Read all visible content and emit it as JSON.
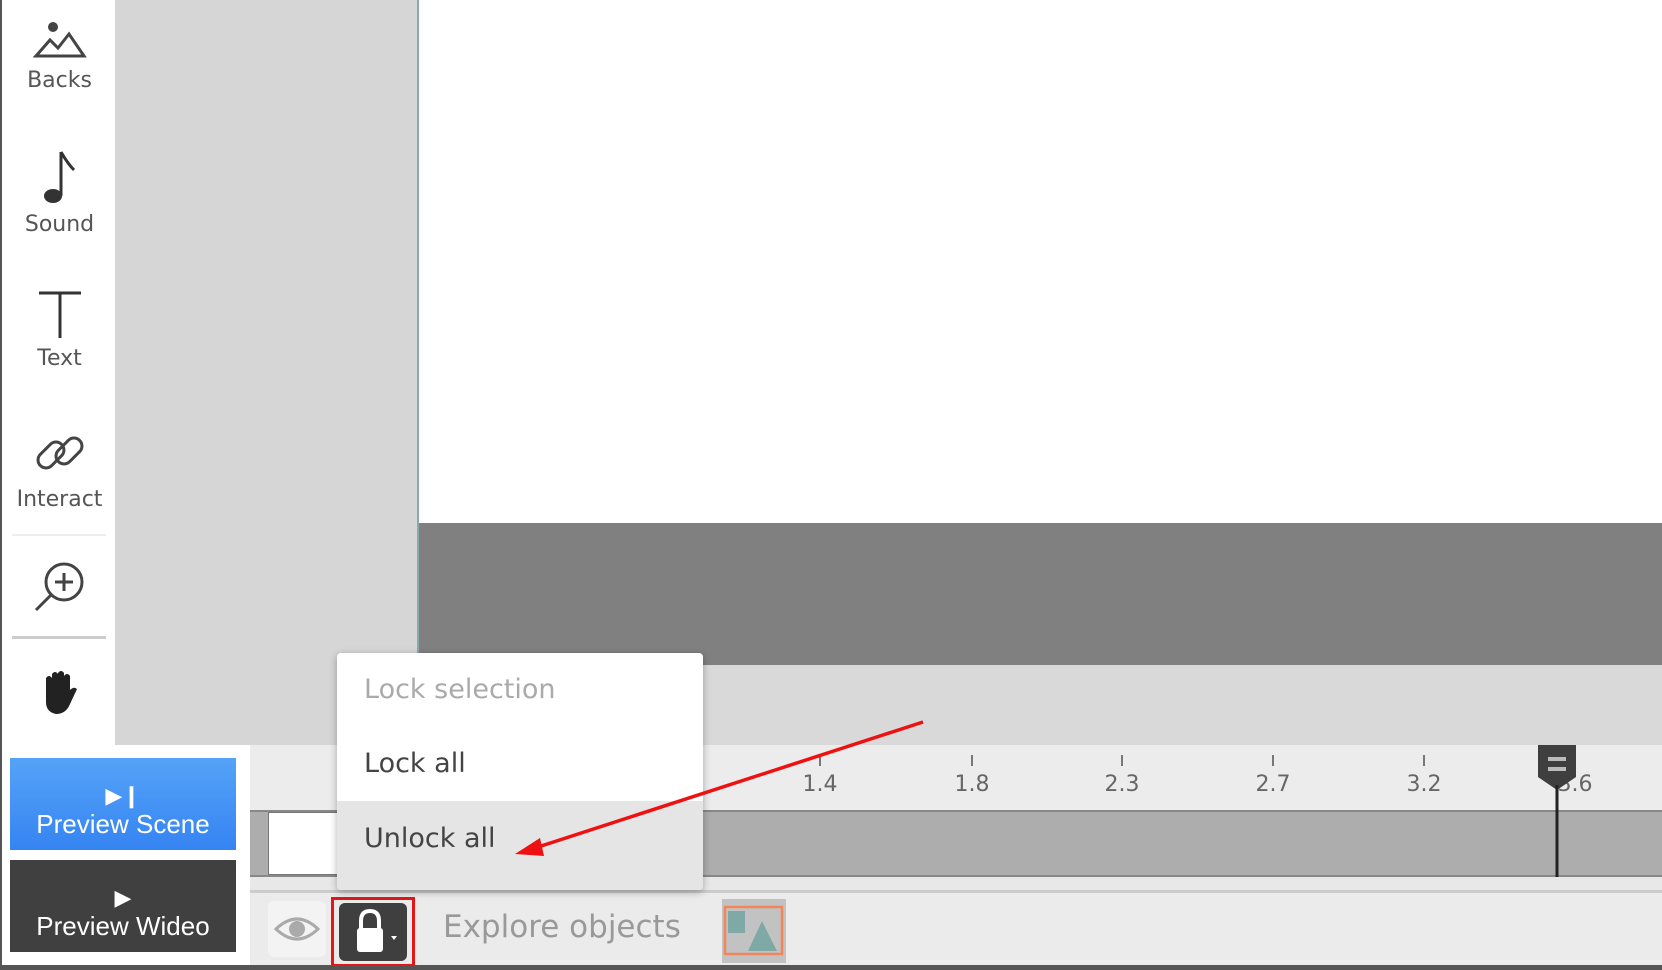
{
  "sidebar": {
    "items": [
      {
        "label": "Backs",
        "icon": "mountain-icon"
      },
      {
        "label": "Sound",
        "icon": "music-note-icon"
      },
      {
        "label": "Text",
        "icon": "text-icon"
      },
      {
        "label": "Interact",
        "icon": "link-icon"
      }
    ],
    "zoom_icon": "zoom-in-icon",
    "hand_icon": "hand-icon"
  },
  "preview": {
    "scene_label": "Preview Scene",
    "video_label": "Preview Wideo",
    "scene_color": "#3d8ef5",
    "video_color": "#404040"
  },
  "timeline": {
    "ticks": [
      "1.4",
      "1.8",
      "2.3",
      "2.7",
      "3.2",
      "3.6"
    ]
  },
  "lock_menu": {
    "items": [
      {
        "label": "Lock selection",
        "disabled": true
      },
      {
        "label": "Lock all",
        "disabled": false
      },
      {
        "label": "Unlock all",
        "disabled": false,
        "highlighted": true
      }
    ]
  },
  "bottom_bar": {
    "explore_label": "Explore objects"
  },
  "annotation": {
    "color": "#ee1111"
  }
}
